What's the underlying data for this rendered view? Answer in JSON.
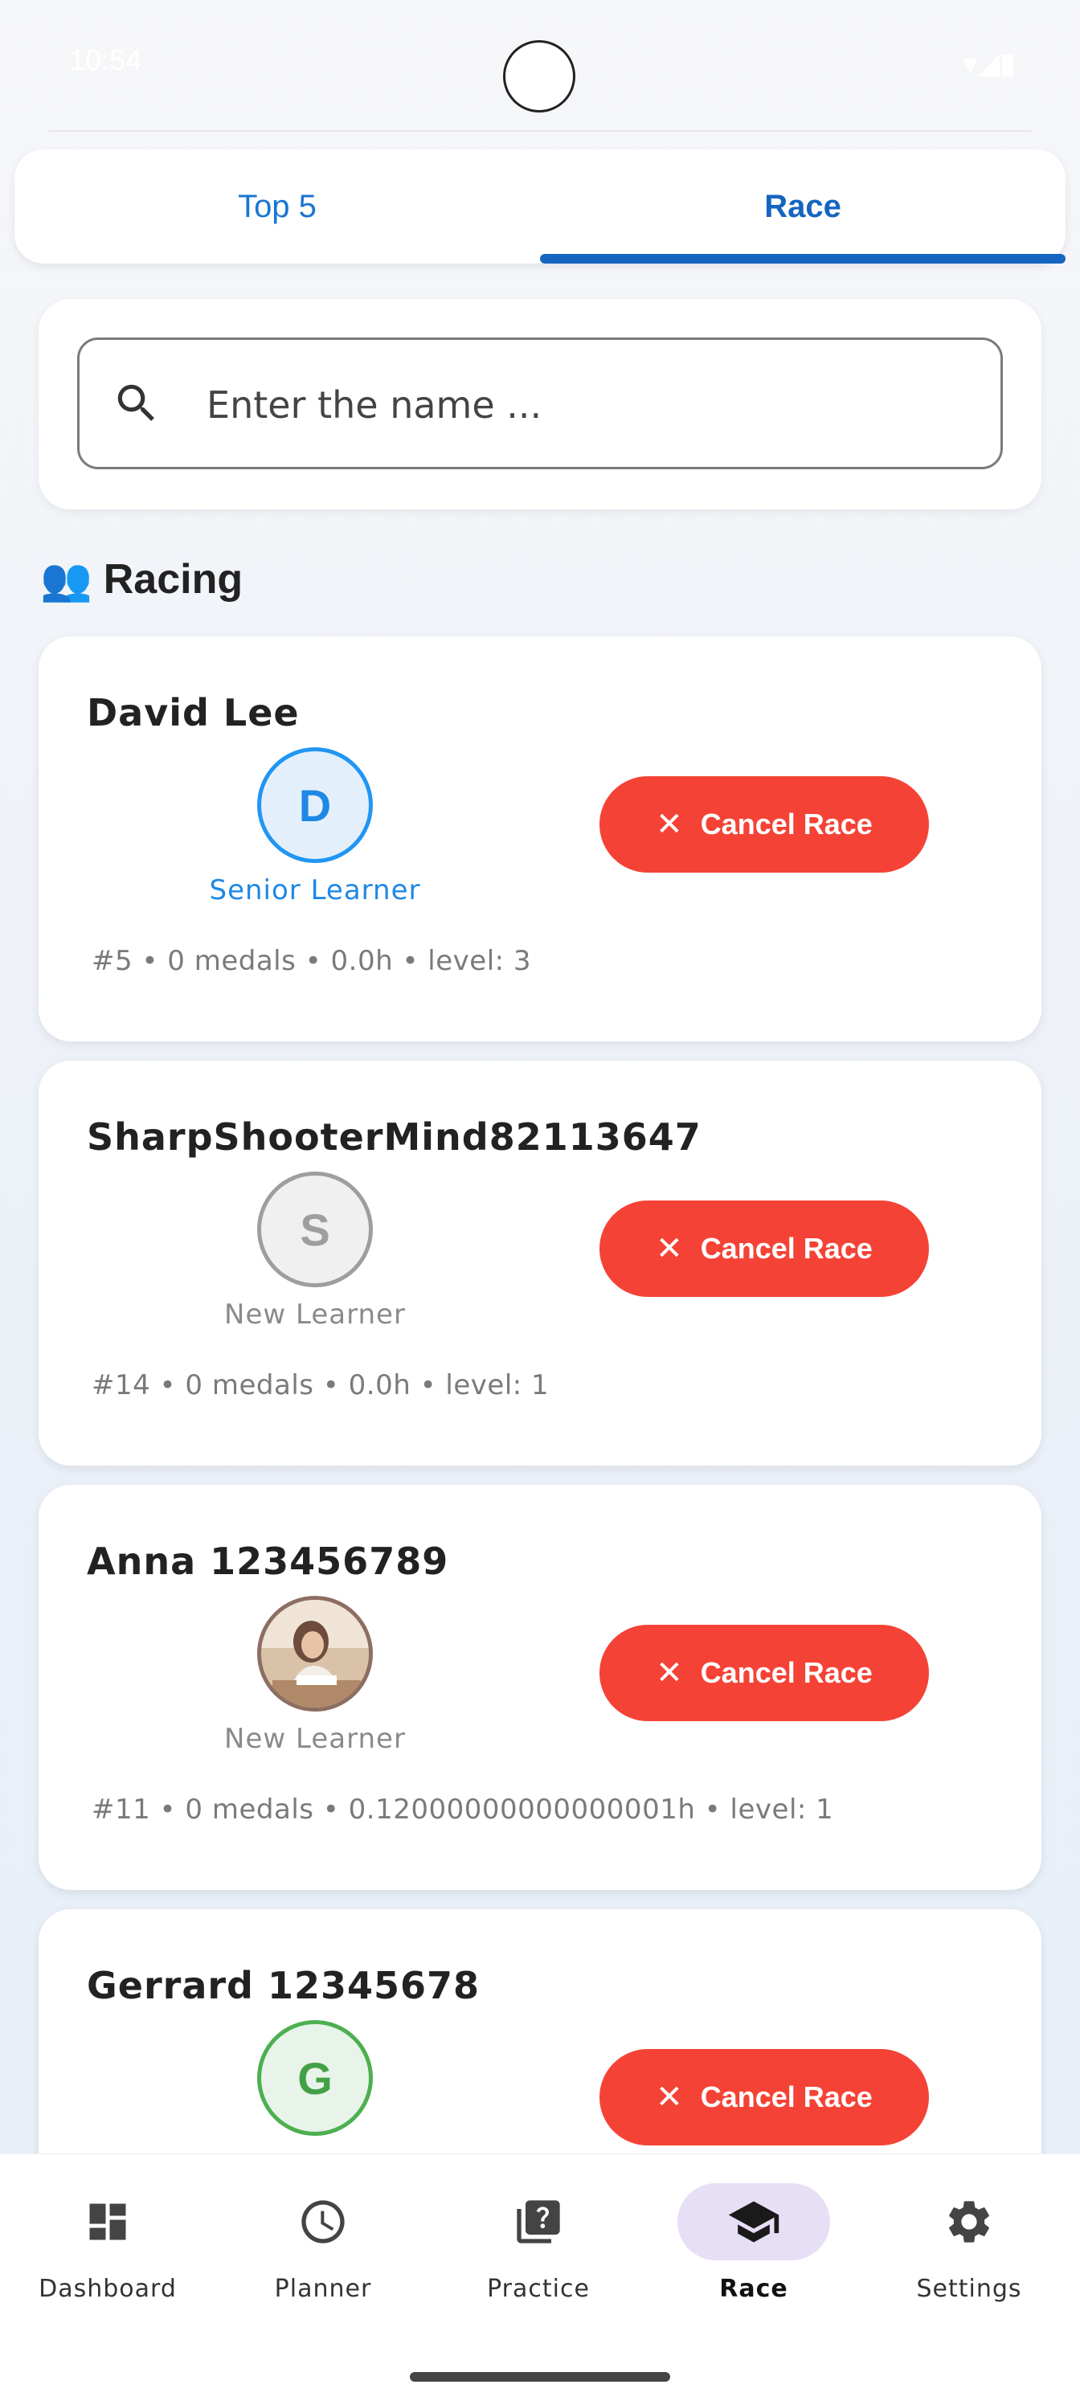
{
  "status": {
    "time": "10:54"
  },
  "tabs": [
    {
      "label": "Top 5",
      "selected": false
    },
    {
      "label": "Race",
      "selected": true
    }
  ],
  "search": {
    "placeholder": "Enter the name ...",
    "value": ""
  },
  "section": {
    "icon": "👥",
    "title": "Racing"
  },
  "racers": [
    {
      "name": "David Lee",
      "initial": "D",
      "avatar": "blue",
      "label": "Senior Learner",
      "label_color": "blue",
      "button": "Cancel Race",
      "meta": "#5 • 0 medals • 0.0h • level: 3"
    },
    {
      "name": "SharpShooterMind82113647",
      "initial": "S",
      "avatar": "grey",
      "label": "New Learner",
      "label_color": "grey",
      "button": "Cancel Race",
      "meta": "#14 • 0 medals • 0.0h • level: 1"
    },
    {
      "name": "Anna 123456789",
      "initial": "",
      "avatar": "photo",
      "label": "New Learner",
      "label_color": "grey",
      "button": "Cancel Race",
      "meta": "#11 • 0 medals • 0.12000000000000001h • level: 1"
    },
    {
      "name": "Gerrard 12345678",
      "initial": "G",
      "avatar": "green",
      "label": "",
      "label_color": "grey",
      "button": "Cancel Race",
      "meta": ""
    }
  ],
  "nav": [
    {
      "label": "Dashboard",
      "icon": "dashboard-icon",
      "active": false
    },
    {
      "label": "Planner",
      "icon": "clock-icon",
      "active": false
    },
    {
      "label": "Practice",
      "icon": "quiz-icon",
      "active": false
    },
    {
      "label": "Race",
      "icon": "graduation-cap-icon",
      "active": true
    },
    {
      "label": "Settings",
      "icon": "gear-icon",
      "active": false
    }
  ],
  "colors": {
    "primary": "#1565c0",
    "cancel": "#f44336",
    "active_nav_bg": "#e7dff6"
  }
}
